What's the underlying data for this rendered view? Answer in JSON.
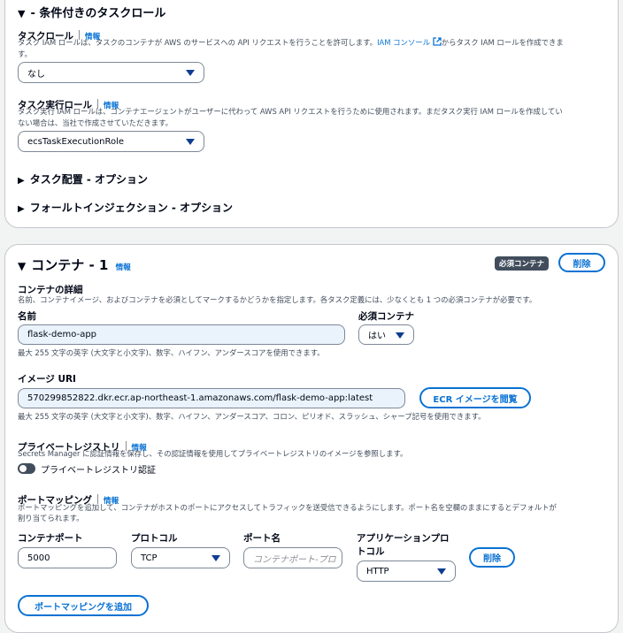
{
  "section1": {
    "conditional_roles_heading": "- 条件付きのタスクロール",
    "task_role": {
      "label": "タスクロール",
      "info": "情報",
      "desc_before": "タスク IAM ロールは、タスクのコンテナが AWS のサービスへの API リクエストを行うことを許可します。",
      "desc_link": "IAM コンソール",
      "desc_after": "からタスク IAM ロールを作成できま",
      "desc_line2": "す。",
      "value": "なし"
    },
    "exec_role": {
      "label": "タスク実行ロール",
      "info": "情報",
      "desc_line1": "タスク実行 IAM ロールは、コンテナエージェントがユーザーに代わって AWS API リクエストを行うために使用されます。まだタスク実行 IAM ロールを作成してい",
      "desc_line2": "ない場合は、当社で作成させていただきます。",
      "value": "ecsTaskExecutionRole"
    },
    "placement_heading": "タスク配置 - オプション",
    "fault_heading": "フォールトインジェクション - オプション"
  },
  "container": {
    "title": "コンテナ - 1",
    "info": "情報",
    "essential_badge": "必須コンテナ",
    "remove_label": "削除",
    "details_label": "コンテナの詳細",
    "details_desc": "名前、コンテナイメージ、およびコンテナを必須としてマークするかどうかを指定します。各タスク定義には、少なくとも 1 つの必須コンテナが必要です。",
    "name_label": "名前",
    "name_value": "flask-demo-app",
    "name_hint": "最大 255 文字の英字 (大文字と小文字)、数字、ハイフン、アンダースコアを使用できます。",
    "essential_label": "必須コンテナ",
    "essential_value": "はい",
    "image_label": "イメージ URI",
    "image_value": "570299852822.dkr.ecr.ap-northeast-1.amazonaws.com/flask-demo-app:latest",
    "browse_ecr_label": "ECR イメージを閲覧",
    "image_hint": "最大 255 文字の英字 (大文字と小文字)、数字、ハイフン、アンダースコア、コロン、ピリオド、スラッシュ、シャープ記号を使用できます。",
    "private_registry_label": "プライベートレジストリ",
    "private_registry_info": "情報",
    "private_registry_desc": "Secrets Manager に認証情報を保存し、その認証情報を使用してプライベートレジストリのイメージを参照します。",
    "private_registry_toggle_label": "プライベートレジストリ認証",
    "port_mapping_label": "ポートマッピング",
    "port_mapping_info": "情報",
    "port_mapping_desc_line1": "ポートマッピングを追加して、コンテナがホストのポートにアクセスしてトラフィックを送受信できるようにします。ポート名を空欄のままにするとデフォルトが",
    "port_mapping_desc_line2": "割り当てられます。",
    "col_container_port": "コンテナポート",
    "col_protocol": "プロトコル",
    "col_port_name": "ポート名",
    "col_app_protocol_line1": "アプリケーションプロ",
    "col_app_protocol_line2": "トコル",
    "container_port_value": "5000",
    "protocol_value": "TCP",
    "port_name_placeholder": "コンテナポート-プロ",
    "app_protocol_value": "HTTP",
    "row_remove_label": "削除",
    "add_port_mapping_label": "ポートマッピングを追加"
  }
}
